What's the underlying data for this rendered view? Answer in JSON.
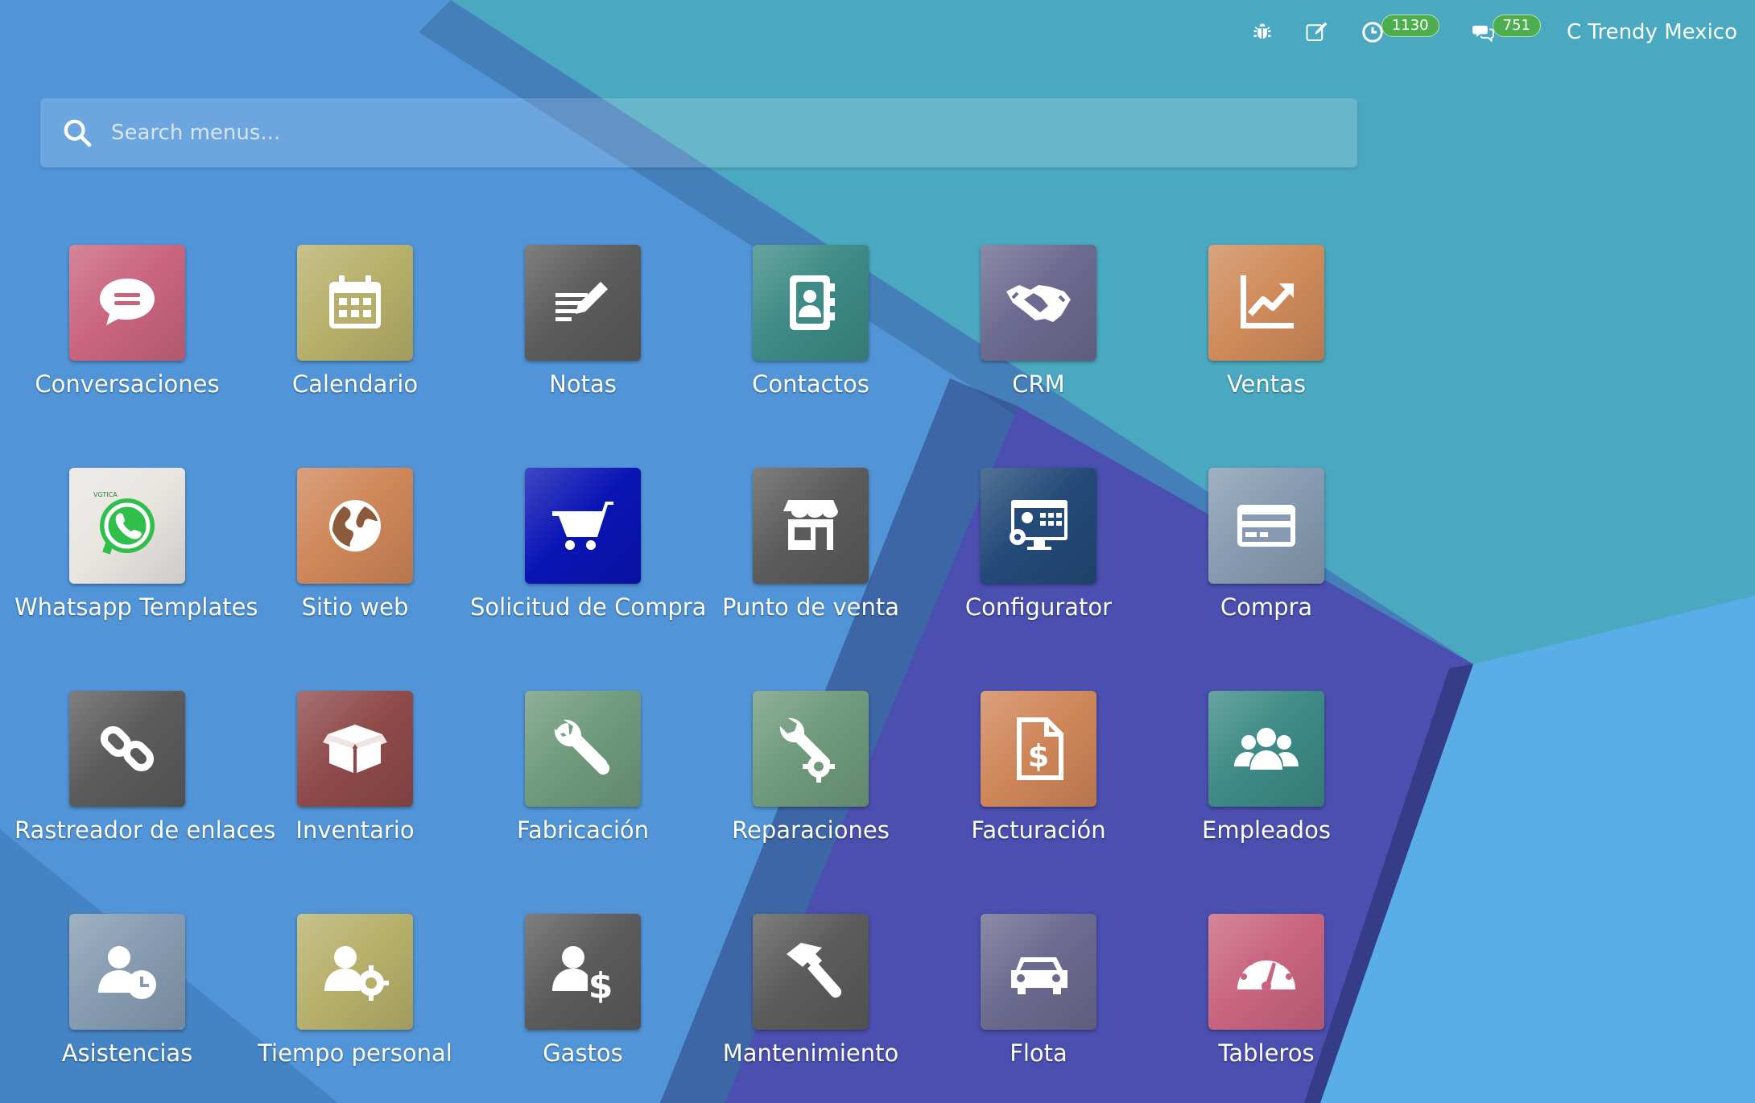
{
  "topbar": {
    "activities_count": "1130",
    "messages_count": "751",
    "company": "C Trendy Mexico"
  },
  "search": {
    "placeholder": "Search menus..."
  },
  "apps": [
    {
      "label": "Conversaciones",
      "color": "#c9647f",
      "icon": "chat-icon"
    },
    {
      "label": "Calendario",
      "color": "#b7b06b",
      "icon": "calendar-icon"
    },
    {
      "label": "Notas",
      "color": "#5b5b5b",
      "icon": "notes-icon"
    },
    {
      "label": "Contactos",
      "color": "#3d8a86",
      "icon": "contacts-icon"
    },
    {
      "label": "CRM",
      "color": "#6b6a8f",
      "icon": "handshake-icon"
    },
    {
      "label": "Ventas",
      "color": "#cf8b5b",
      "icon": "chart-icon"
    },
    {
      "label": "Whatsapp Templates",
      "color": "#e9e6e2",
      "icon": "whatsapp-icon"
    },
    {
      "label": "Sitio web",
      "color": "#cf8659",
      "icon": "globe-icon"
    },
    {
      "label": "Solicitud de Compra",
      "color": "#0a14b4",
      "icon": "cart-icon"
    },
    {
      "label": "Punto de venta",
      "color": "#5b5b5b",
      "icon": "store-icon"
    },
    {
      "label": "Configurator",
      "color": "#234a78",
      "icon": "monitor-icon"
    },
    {
      "label": "Compra",
      "color": "#869bb1",
      "icon": "credit-card-icon"
    },
    {
      "label": "Rastreador de enlaces",
      "color": "#5b5b5b",
      "icon": "link-icon"
    },
    {
      "label": "Inventario",
      "color": "#8f4a4a",
      "icon": "box-icon"
    },
    {
      "label": "Fabricación",
      "color": "#6f9a7c",
      "icon": "wrench-icon"
    },
    {
      "label": "Reparaciones",
      "color": "#6f9a7c",
      "icon": "wrench-gear-icon"
    },
    {
      "label": "Facturación",
      "color": "#cf8659",
      "icon": "invoice-icon"
    },
    {
      "label": "Empleados",
      "color": "#3d8a86",
      "icon": "users-icon"
    },
    {
      "label": "Asistencias",
      "color": "#869bb1",
      "icon": "user-clock-icon"
    },
    {
      "label": "Tiempo personal",
      "color": "#b7b06b",
      "icon": "user-gear-icon"
    },
    {
      "label": "Gastos",
      "color": "#5b5b5b",
      "icon": "user-dollar-icon"
    },
    {
      "label": "Mantenimiento",
      "color": "#5b5b5b",
      "icon": "hammer-icon"
    },
    {
      "label": "Flota",
      "color": "#6b6a8f",
      "icon": "car-icon"
    },
    {
      "label": "Tableros",
      "color": "#c9647f",
      "icon": "gauge-icon"
    }
  ]
}
